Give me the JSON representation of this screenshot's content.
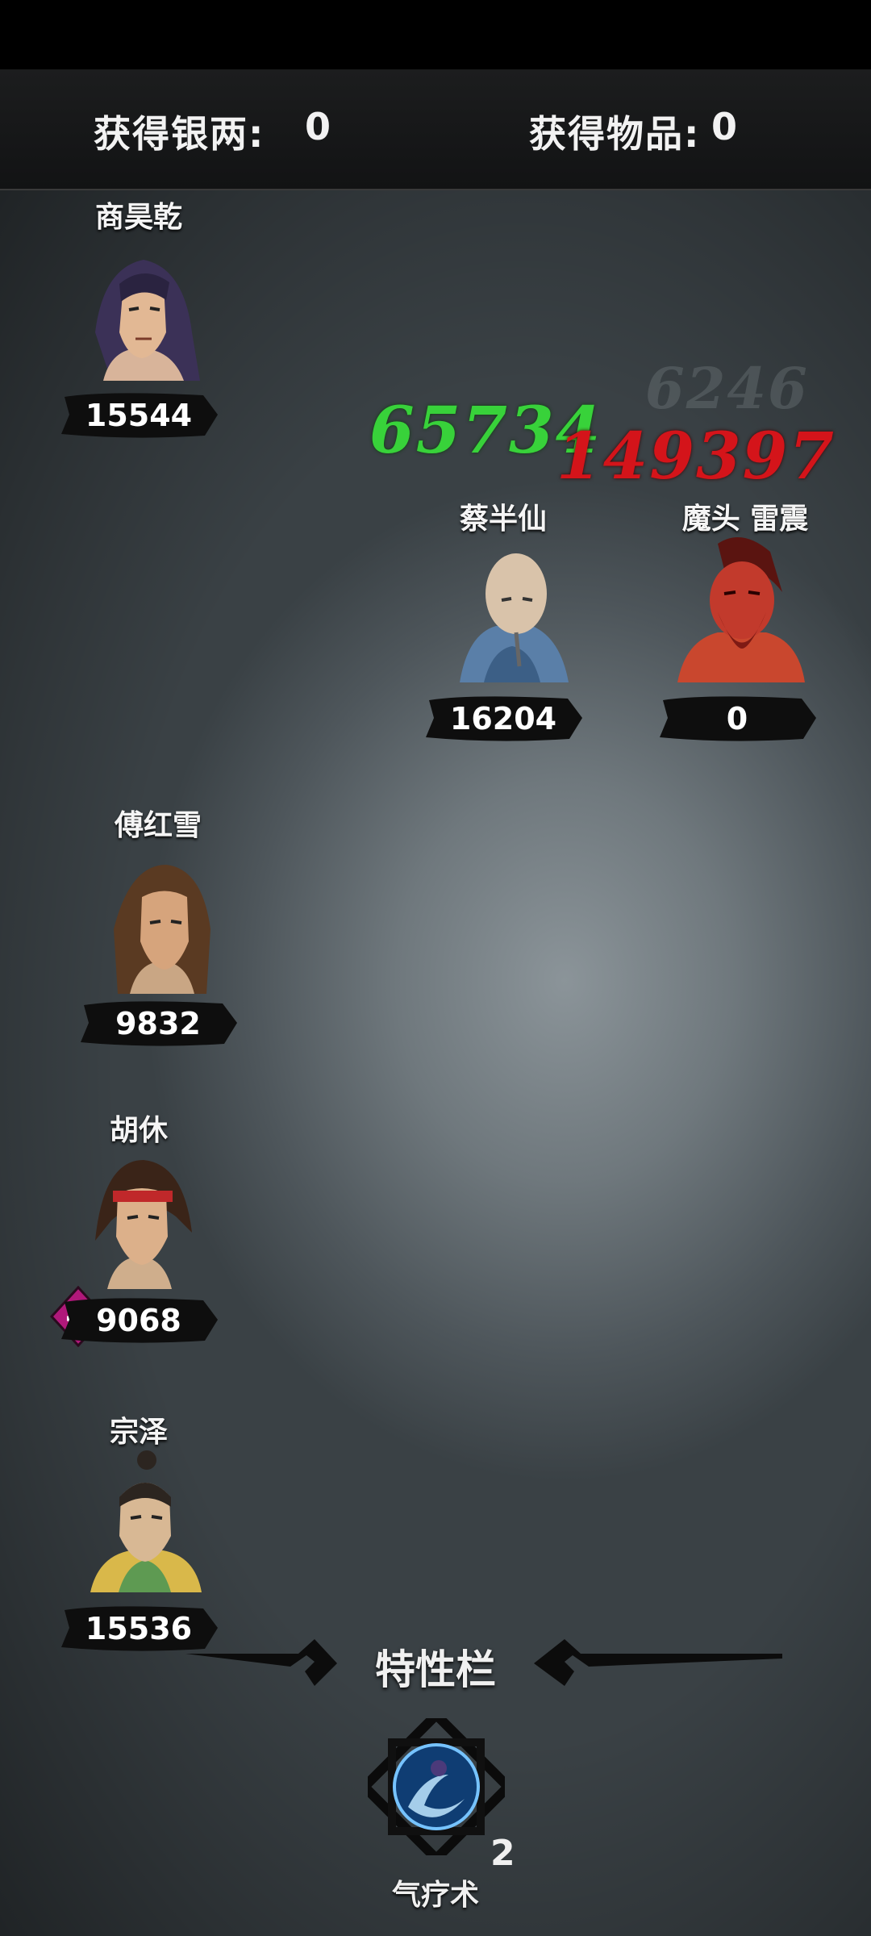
{
  "header": {
    "silver_label": "获得银两:",
    "silver_value": "0",
    "items_label": "获得物品:",
    "items_value": "0"
  },
  "allies": [
    {
      "name": "商昊乾",
      "hp": "15544",
      "portrait": "long-haired-warrior-portrait"
    },
    {
      "name": "傅红雪",
      "hp": "9832",
      "portrait": "brown-haired-swordsman-portrait"
    },
    {
      "name": "胡休",
      "hp": "9068",
      "portrait": "headband-fighter-portrait",
      "status_badge": "晕"
    },
    {
      "name": "宗泽",
      "hp": "15536",
      "portrait": "topknot-scholar-portrait"
    }
  ],
  "enemies": [
    {
      "name": "蔡半仙",
      "hp": "16204",
      "portrait": "bald-monk-portrait"
    },
    {
      "name": "魔头  雷震",
      "hp": "0",
      "portrait": "red-demon-portrait"
    }
  ],
  "floating_numbers": {
    "heal": "65734",
    "damage": "149397"
  },
  "traits": {
    "title": "特性栏",
    "skill_name": "气疗术",
    "skill_count": "2",
    "skill_icon": "qi-healing-orb-icon"
  },
  "colors": {
    "heal": "#38d23a",
    "damage": "#d4141a",
    "stun_badge": "#b0187a"
  }
}
